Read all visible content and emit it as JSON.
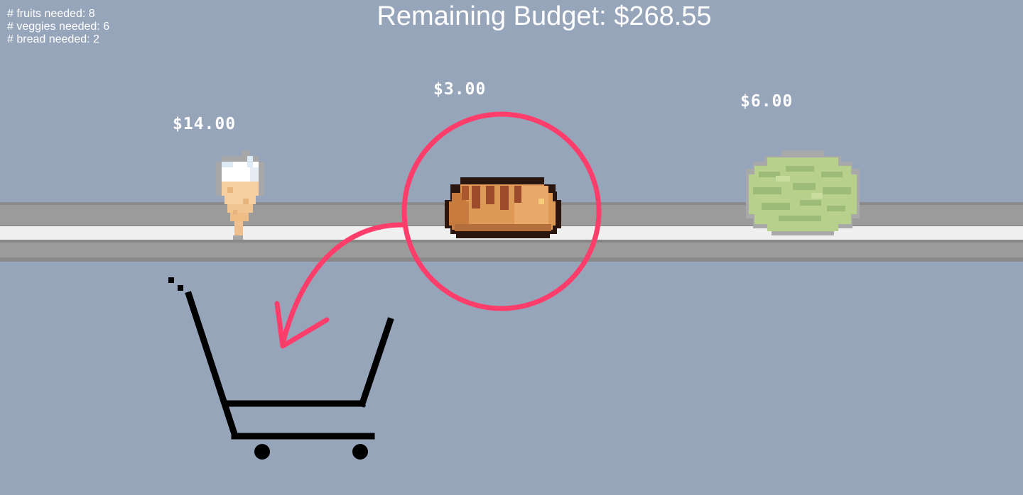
{
  "hud": {
    "needs": [
      "# fruits needed: 8",
      "# veggies needed: 6",
      "# bread needed: 2"
    ],
    "budget": "Remaining Budget: $268.55"
  },
  "items": [
    {
      "name": "ice cream cone",
      "icon": "ice-cream-icon",
      "price": "$14.00"
    },
    {
      "name": "bread loaf",
      "icon": "bread-icon",
      "price": "$3.00",
      "highlighted": true
    },
    {
      "name": "melon",
      "icon": "melon-icon",
      "price": "$6.00"
    }
  ],
  "overlay": {
    "highlight_color": "#ff3d6b",
    "cart_icon": "shopping-cart-icon",
    "arrow_icon": "curved-arrow-icon"
  },
  "colors": {
    "background": "#97a5ba",
    "belt": "#9b9b9b",
    "belt_stripe": "#efefef"
  }
}
